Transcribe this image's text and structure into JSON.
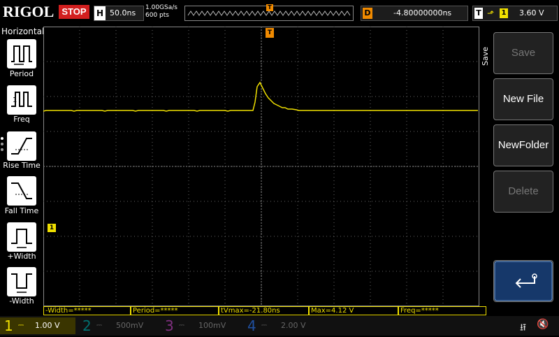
{
  "brand": "RIGOL",
  "run_state": "STOP",
  "horizontal": {
    "key": "H",
    "scale": "50.0ns",
    "sample_rate": "1.00GSa/s",
    "points": "600 pts"
  },
  "delay": {
    "key": "D",
    "value": "-4.80000000ns"
  },
  "trigger": {
    "key": "T",
    "source": "1",
    "level": "3.60 V"
  },
  "left_menu": {
    "title": "Horizontal",
    "items": [
      {
        "label": "Period",
        "icon": "period-icon"
      },
      {
        "label": "Freq",
        "icon": "frequency-icon"
      },
      {
        "label": "Rise Time",
        "icon": "rise-time-icon"
      },
      {
        "label": "Fall Time",
        "icon": "fall-time-icon"
      },
      {
        "label": "+Width",
        "icon": "positive-width-icon"
      },
      {
        "label": "-Width",
        "icon": "negative-width-icon"
      }
    ]
  },
  "right_menu": {
    "title": "Save",
    "buttons": [
      {
        "label": "Save",
        "enabled": false
      },
      {
        "label": "New File",
        "enabled": true
      },
      {
        "label": "NewFolder",
        "enabled": true
      },
      {
        "label": "Delete",
        "enabled": false
      }
    ],
    "return_icon": "return-arrow-icon"
  },
  "measurements": [
    {
      "text": "-Width=*****"
    },
    {
      "text": "Period=*****"
    },
    {
      "text": "tVmax=-21.80ns"
    },
    {
      "text": "Max=4.12 V"
    },
    {
      "text": "Freq=*****"
    }
  ],
  "channels": [
    {
      "num": "1",
      "value": "1.00 V",
      "color": "#f0e000",
      "active": true
    },
    {
      "num": "2",
      "value": "500mV",
      "color": "#00b5b5",
      "active": false
    },
    {
      "num": "3",
      "value": "100mV",
      "color": "#c040c0",
      "active": false
    },
    {
      "num": "4",
      "value": "2.00 V",
      "color": "#2080ff",
      "active": false
    }
  ],
  "markers": {
    "trigger_top": "T",
    "trigger_level": "T",
    "ch1_offset": "1"
  },
  "status_icons": [
    "usb-icon",
    "sound-muted-icon"
  ],
  "colors": {
    "ch1": "#f0e000",
    "trigger": "#f08a00",
    "stop": "#d21f1f",
    "grid": "#666666"
  }
}
